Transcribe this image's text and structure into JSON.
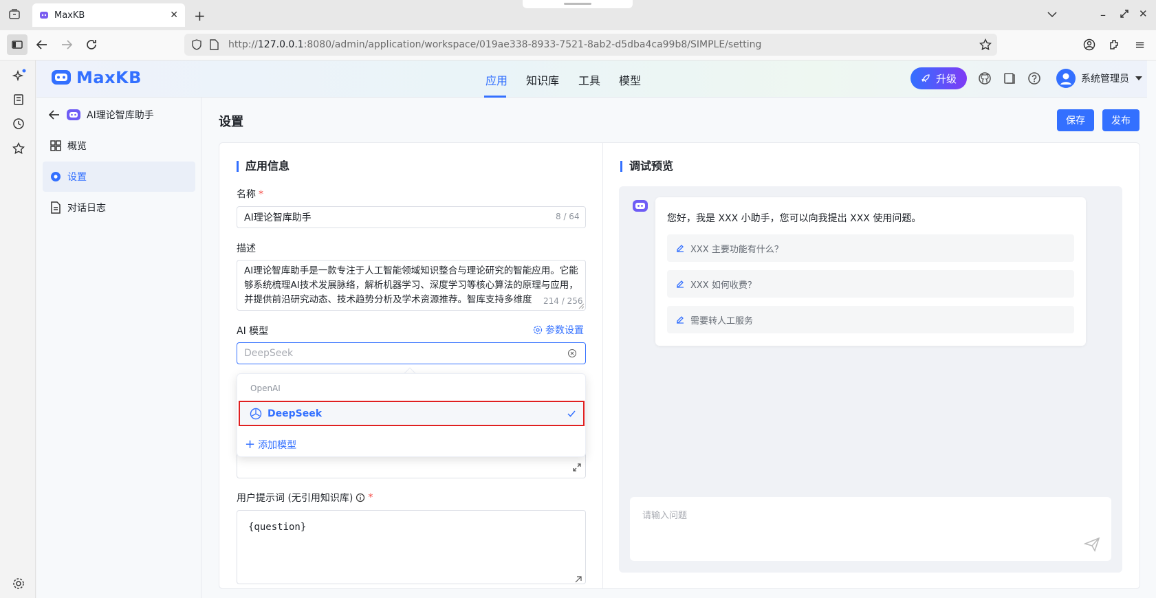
{
  "browser": {
    "tab_title": "MaxKB",
    "url_prefix": "http://",
    "url_host": "127.0.0.1",
    "url_rest": ":8080/admin/application/workspace/019ae338-8933-7521-8ab2-d5dba4ca99b8/SIMPLE/setting"
  },
  "header": {
    "logo_text": "MaxKB",
    "nav": [
      "应用",
      "知识库",
      "工具",
      "模型"
    ],
    "upgrade_label": "升级",
    "user_name": "系统管理员"
  },
  "sidebar": {
    "app_name": "AI理论智库助手",
    "items": [
      {
        "label": "概览",
        "icon": "overview-icon"
      },
      {
        "label": "设置",
        "icon": "gear-icon"
      },
      {
        "label": "对话日志",
        "icon": "document-icon"
      }
    ]
  },
  "page": {
    "title": "设置",
    "save_label": "保存",
    "publish_label": "发布"
  },
  "app_info": {
    "section_title": "应用信息",
    "name_label": "名称",
    "name_value": "AI理论智库助手",
    "name_count": "8 / 64",
    "desc_label": "描述",
    "desc_value": "AI理论智库助手是一款专注于人工智能领域知识整合与理论研究的智能应用。它能够系统梳理AI技术发展脉络，解析机器学习、深度学习等核心算法的原理与应用，并提供前沿研究动态、技术趋势分析及学术资源推荐。智库支持多维度",
    "desc_count": "214 / 256",
    "model_label": "AI 模型",
    "param_settings": "参数设置",
    "model_placeholder": "DeepSeek",
    "dropdown_group": "OpenAI",
    "dropdown_option": "DeepSeek",
    "add_model": "添加模型",
    "user_prompt_label": "用户提示词 (无引用知识库)",
    "user_prompt_value": "{question}"
  },
  "preview": {
    "section_title": "调试预览",
    "greeting": "您好，我是 XXX 小助手，您可以向我提出 XXX 使用问题。",
    "questions": [
      "XXX 主要功能有什么？",
      "XXX 如何收费？",
      "需要转人工服务"
    ],
    "input_placeholder": "请输入问题"
  },
  "colors": {
    "accent": "#3370ff",
    "highlight_border": "#e02020"
  }
}
